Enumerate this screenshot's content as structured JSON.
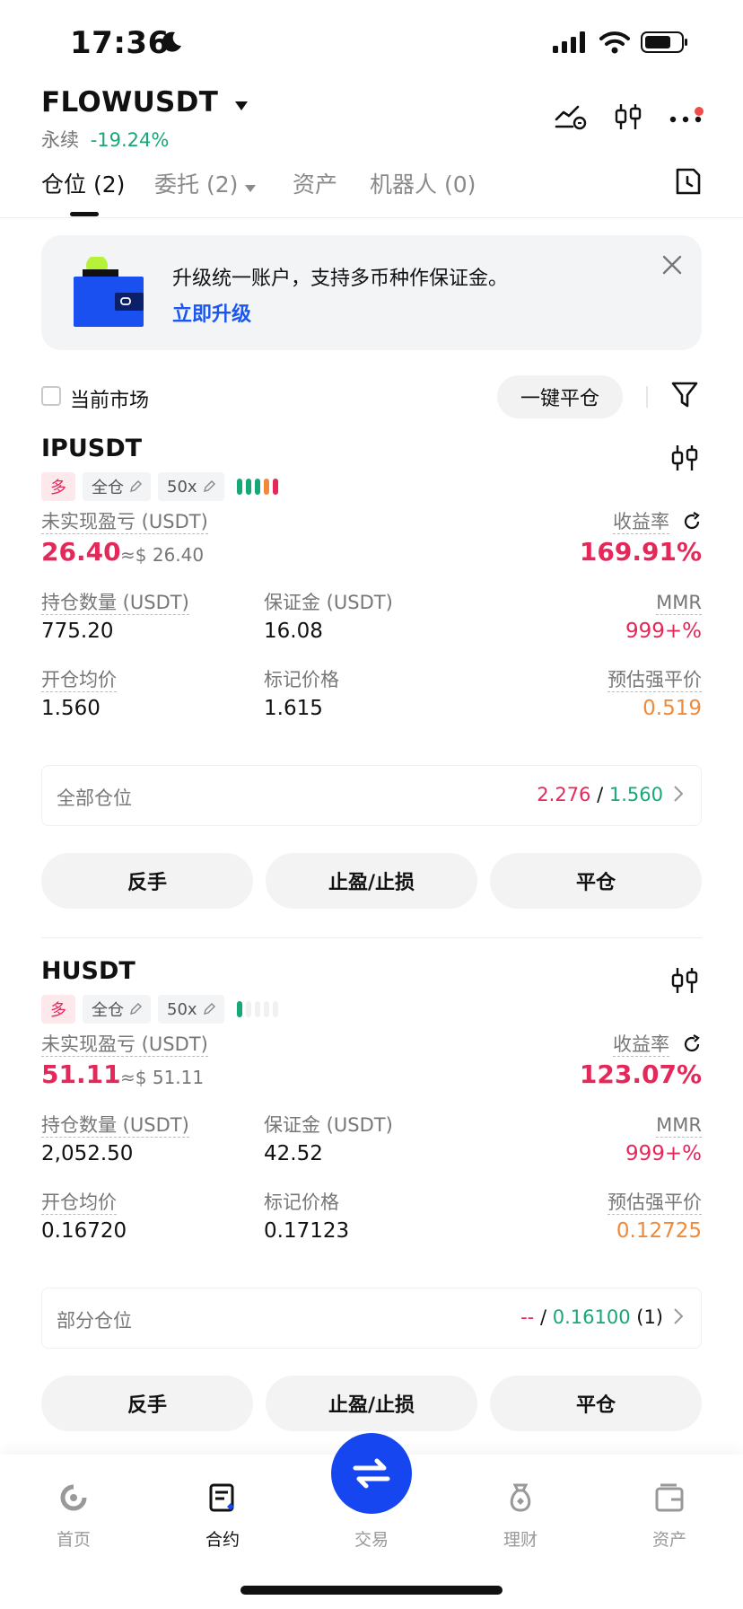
{
  "status_bar": {
    "time": "17:36"
  },
  "header": {
    "symbol": "FLOWUSDT",
    "type": "永续",
    "change": "-19.24%"
  },
  "tabs": [
    {
      "label": "仓位 (2)"
    },
    {
      "label": "委托 (2)"
    },
    {
      "label": "资产"
    },
    {
      "label": "机器人 (0)"
    }
  ],
  "banner": {
    "text": "升级统一账户，支持多币种作保证金。",
    "link": "立即升级"
  },
  "filter": {
    "current_market": "当前市场",
    "close_all": "一键平仓"
  },
  "positions": [
    {
      "pair": "IPUSDT",
      "side": "多",
      "margin_mode": "全仓",
      "leverage": "50x",
      "pnl_label": "未实现盈亏 (USDT)",
      "pnl": "26.40",
      "pnl_usd": "≈$ 26.40",
      "roe_label": "收益率",
      "roe": "169.91%",
      "size_label": "持仓数量 (USDT)",
      "size": "775.20",
      "margin_label": "保证金 (USDT)",
      "margin": "16.08",
      "mmr_label": "MMR",
      "mmr": "999+%",
      "entry_label": "开仓均价",
      "entry": "1.560",
      "mark_label": "标记价格",
      "mark": "1.615",
      "liq_label": "预估强平价",
      "liq": "0.519",
      "tpsl_label": "全部仓位",
      "tp": "2.276",
      "sl": "1.560",
      "tpsl_count": "",
      "buttons": [
        "反手",
        "止盈/止损",
        "平仓"
      ],
      "risk_bars": 5
    },
    {
      "pair": "HUSDT",
      "side": "多",
      "margin_mode": "全仓",
      "leverage": "50x",
      "pnl_label": "未实现盈亏 (USDT)",
      "pnl": "51.11",
      "pnl_usd": "≈$ 51.11",
      "roe_label": "收益率",
      "roe": "123.07%",
      "size_label": "持仓数量 (USDT)",
      "size": "2,052.50",
      "margin_label": "保证金 (USDT)",
      "margin": "42.52",
      "mmr_label": "MMR",
      "mmr": "999+%",
      "entry_label": "开仓均价",
      "entry": "0.16720",
      "mark_label": "标记价格",
      "mark": "0.17123",
      "liq_label": "预估强平价",
      "liq": "0.12725",
      "tpsl_label": "部分仓位",
      "tp": "--",
      "sl": "0.16100",
      "tpsl_count": "(1)",
      "buttons": [
        "反手",
        "止盈/止损",
        "平仓"
      ],
      "risk_bars": 1
    }
  ],
  "bottom_nav": [
    {
      "label": "首页"
    },
    {
      "label": "合约"
    },
    {
      "label": "交易"
    },
    {
      "label": "理财"
    },
    {
      "label": "资产"
    }
  ],
  "colors": {
    "brand": "#1546f0",
    "up": "#16a878",
    "down": "#e5285a",
    "warn": "#f08a3a"
  }
}
